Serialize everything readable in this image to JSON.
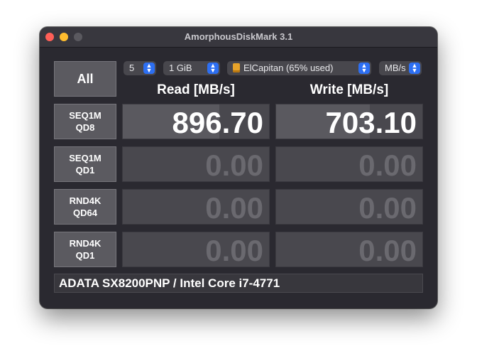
{
  "window": {
    "title": "AmorphousDiskMark 3.1"
  },
  "controls": {
    "all_label": "All",
    "count": "5",
    "size": "1 GiB",
    "drive": "ElCapitan (65% used)",
    "unit": "MB/s"
  },
  "columns": {
    "read": "Read [MB/s]",
    "write": "Write [MB/s]"
  },
  "rows": [
    {
      "line1": "SEQ1M",
      "line2": "QD8",
      "read": "896.70",
      "write": "703.10",
      "read_fraction": 0.66,
      "write_fraction": 0.64
    },
    {
      "line1": "SEQ1M",
      "line2": "QD1",
      "read": "0.00",
      "write": "0.00",
      "read_fraction": 0,
      "write_fraction": 0
    },
    {
      "line1": "RND4K",
      "line2": "QD64",
      "read": "0.00",
      "write": "0.00",
      "read_fraction": 0,
      "write_fraction": 0
    },
    {
      "line1": "RND4K",
      "line2": "QD1",
      "read": "0.00",
      "write": "0.00",
      "read_fraction": 0,
      "write_fraction": 0
    }
  ],
  "footer": {
    "info": "ADATA SX8200PNP / Intel Core i7-4771"
  },
  "colors": {
    "accent": "#2d6ff2",
    "close": "#fe5f57",
    "minimize": "#febc2e"
  },
  "icons": {
    "drive": "drive-icon",
    "popup": "chevron-up-down-icon"
  }
}
